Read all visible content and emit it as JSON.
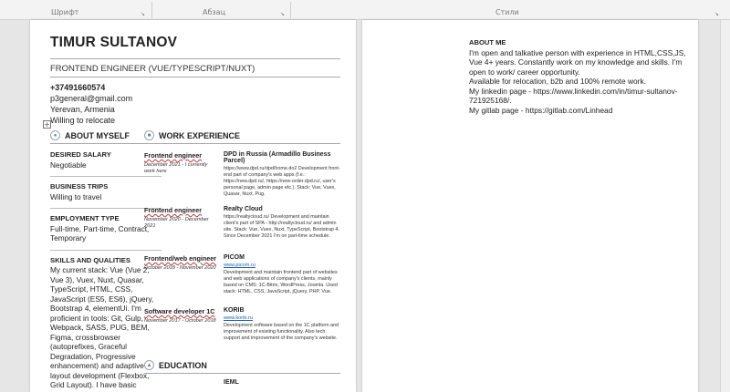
{
  "ribbon": {
    "groups": [
      {
        "label": "Шрифт"
      },
      {
        "label": "Абзац"
      },
      {
        "label": "Стили"
      }
    ],
    "launcher_glyph": "↘"
  },
  "resume": {
    "name": "TIMUR SULTANOV",
    "position": "FRONTEND ENGINEER (VUE/TYPESCRIPT/NUXT)",
    "phone": "+37491660574",
    "email": "p3general@gmail.com",
    "location": "Yerevan, Armenia",
    "relocate": "Willing to relocate",
    "about_heading": "ABOUT MYSELF",
    "work_heading": "WORK EXPERIENCE",
    "education_heading": "EDUCATION",
    "left_blocks": [
      {
        "label": "DESIRED SALARY",
        "value": "Negotiable"
      },
      {
        "label": "BUSINESS TRIPS",
        "value": "Willing to travel"
      },
      {
        "label": "EMPLOYMENT TYPE",
        "value": "Full-time, Part-time, Contract, Temporary"
      },
      {
        "label": "SKILLS AND QUALITIES",
        "value": "My current stack: Vue (Vue 2, Vue 3), Vuex, Nuxt, Quasar, TypeScript, HTML, CSS, JavaScript (ES5, ES6), jQuery, Bootstrap 4, elementUi. I'm proficient in tools: Git, Gulp, Webpack, SASS, PUG, BEM, Figma, crossbrowser (autoprefixes, Graceful Degradation, Progressive enhancement) and adaptive layout development (Flexbox, Grid Layout). I have basic"
      }
    ],
    "jobs": [
      {
        "title": "Frontend engineer",
        "period": "December 2021 - I currently work here",
        "company": "DPD in Russia (Armadillo Business Parcel)",
        "desc": "https://www.dpd.ru/dpd/home.do2 Development front-end part of company's web apps (f.e.: https://new.dpd.ru/, https://new-order.dpd.ru/, user's personal page, admin page etc.). Stack: Vue, Vuex, Quasar, Nuxt, Pug.",
        "link": ""
      },
      {
        "title": "Frontend engineer",
        "period": "November 2020 - December 2021",
        "company": "Realty Cloud",
        "desc": "https://realtycloud.ru/ Development and maintain client's part of SPA - http://realtycloud.ru/ and admin site. Stack: Vue, Vuex, Nuxt, TypeScript, Bootstrap 4. Since December 2021 I'm on part-time schedule.",
        "link": ""
      },
      {
        "title": "Frontend/web engineer",
        "period": "October 2018 - November 2020",
        "company": "PICOM",
        "desc": "Development and maintain frontend part of websites and web applications of company's clients, mainly based on CMS: 1C-Bitrix, WordPress, Joomla. Used stack: HTML, CSS, JavaScript, jQuery, PHP, Vue.",
        "link": "www.picom.ru"
      },
      {
        "title": "Software developer 1C",
        "period": "November 2017 - October 2018",
        "company": "KORIB",
        "desc": "Development software based on the 1C platform and improvement of existing functionality. Also tech. support and improvement of the company's website.",
        "link": "www.korib.ru"
      }
    ],
    "education_org": "IEML"
  },
  "about_me": {
    "heading": "ABOUT ME",
    "lines": [
      "I'm open and talkative person with experience in HTML,CSS,JS,",
      "Vue 4+ years. Constantly work on my knowledge and skills.  I'm",
      "open to work/ career opportunity.",
      "Available for relocation, b2b and 100% remote work.",
      "My linkedin page - https://www.linkedin.com/in/timur-sultanov-",
      "721925168/.",
      "My gitlab page - https://gitlab.com/Linhead"
    ]
  },
  "colors": {
    "link": "#1a5fb4",
    "spellcheck": "#cc3333",
    "page_bg": "#ffffff",
    "workspace_bg": "#e6e6e6"
  },
  "icons": {
    "about_icon": "person-icon",
    "work_icon": "briefcase-icon",
    "education_icon": "graduation-cap-icon",
    "table_handle": "move-handle-icon"
  }
}
